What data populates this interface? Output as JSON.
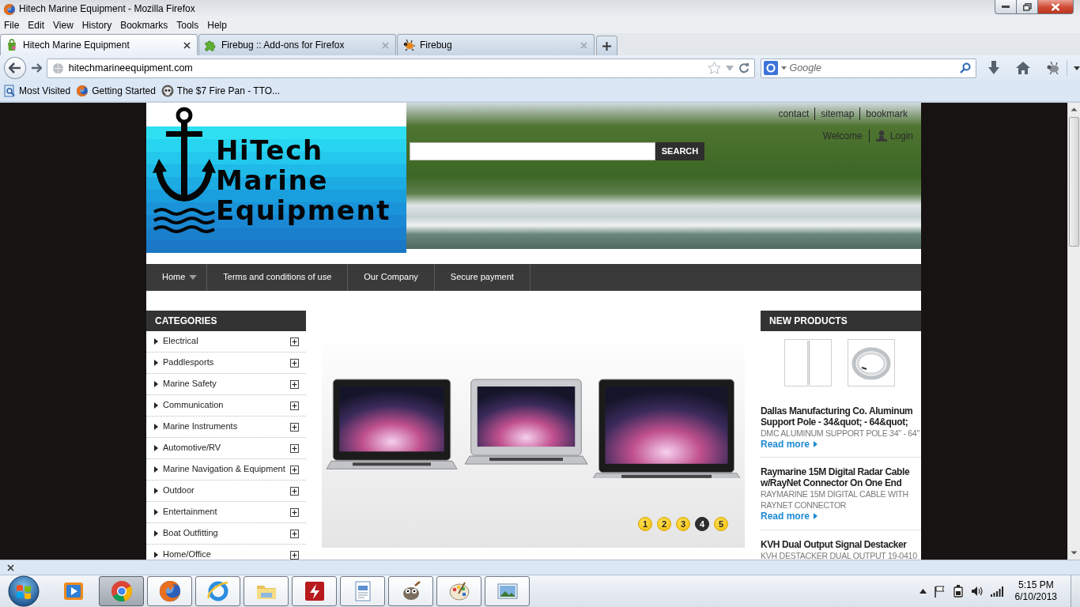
{
  "window": {
    "title": "Hitech Marine Equipment - Mozilla Firefox"
  },
  "menu": [
    "File",
    "Edit",
    "View",
    "History",
    "Bookmarks",
    "Tools",
    "Help"
  ],
  "tabs": [
    {
      "label": "Hitech Marine Equipment",
      "kind": "shop",
      "selected": true
    },
    {
      "label": "Firebug :: Add-ons for Firefox",
      "kind": "addon",
      "selected": false
    },
    {
      "label": "Firebug",
      "kind": "bug",
      "selected": false
    }
  ],
  "toolbar": {
    "url": "hitechmarineequipment.com",
    "search_placeholder": "Google"
  },
  "bookmarks": [
    {
      "label": "Most Visited",
      "kind": "list"
    },
    {
      "label": "Getting Started",
      "kind": "browser"
    },
    {
      "label": "The $7 Fire Pan - TTO...",
      "kind": "skull"
    }
  ],
  "site": {
    "top_links": [
      "contact",
      "sitemap",
      "bookmark"
    ],
    "welcome": "Welcome",
    "login": "Login",
    "logo": [
      "HiTech",
      "Marine",
      "Equipment"
    ],
    "search_button": "SEARCH",
    "nav": [
      {
        "label": "Home",
        "dropdown": true
      },
      {
        "label": "Terms and conditions of use",
        "dropdown": false
      },
      {
        "label": "Our Company",
        "dropdown": false
      },
      {
        "label": "Secure payment",
        "dropdown": false
      }
    ],
    "categories": {
      "title": "CATEGORIES",
      "items": [
        "Electrical",
        "Paddlesports",
        "Marine Safety",
        "Communication",
        "Marine Instruments",
        "Automotive/RV",
        "Marine Navigation & Equipment",
        "Outdoor",
        "Entertainment",
        "Boat Outfitting",
        "Home/Office"
      ]
    },
    "slider": {
      "pages": [
        {
          "label": "1",
          "selected": false
        },
        {
          "label": "2",
          "selected": false
        },
        {
          "label": "3",
          "selected": false
        },
        {
          "label": "4",
          "selected": true
        },
        {
          "label": "5",
          "selected": false
        }
      ]
    },
    "new_products": {
      "title": "NEW PRODUCTS",
      "items": [
        {
          "name": "Dallas Manufacturing Co. Aluminum Support Pole - 34&quot; - 64&quot;",
          "description": "DMC ALUMINUM SUPPORT POLE 34\" - 64\"",
          "link": "Read more"
        },
        {
          "name": "Raymarine 15M Digital Radar Cable w/RayNet Connector On One End",
          "description": "RAYMARINE 15M DIGITAL CABLE WITH RAYNET CONNECTOR",
          "link": "Read more"
        },
        {
          "name": "KVH Dual Output Signal Destacker",
          "description": "KVH DESTACKER DUAL OUTPUT 19-0410"
        }
      ]
    }
  },
  "taskbar": {
    "apps": [
      {
        "kind": "media",
        "running": false,
        "selected": false
      },
      {
        "kind": "chrome",
        "running": true,
        "selected": true
      },
      {
        "kind": "firefox",
        "running": true,
        "selected": false
      },
      {
        "kind": "ie",
        "running": true,
        "selected": false
      },
      {
        "kind": "explorer",
        "running": true,
        "selected": false
      },
      {
        "kind": "ftp",
        "running": true,
        "selected": false
      },
      {
        "kind": "writer",
        "running": true,
        "selected": false
      },
      {
        "kind": "gimp",
        "running": true,
        "selected": false
      },
      {
        "kind": "paint",
        "running": true,
        "selected": false
      },
      {
        "kind": "photos",
        "running": true,
        "selected": false
      }
    ],
    "clock": {
      "time": "5:15 PM",
      "date": "6/10/2013"
    }
  }
}
